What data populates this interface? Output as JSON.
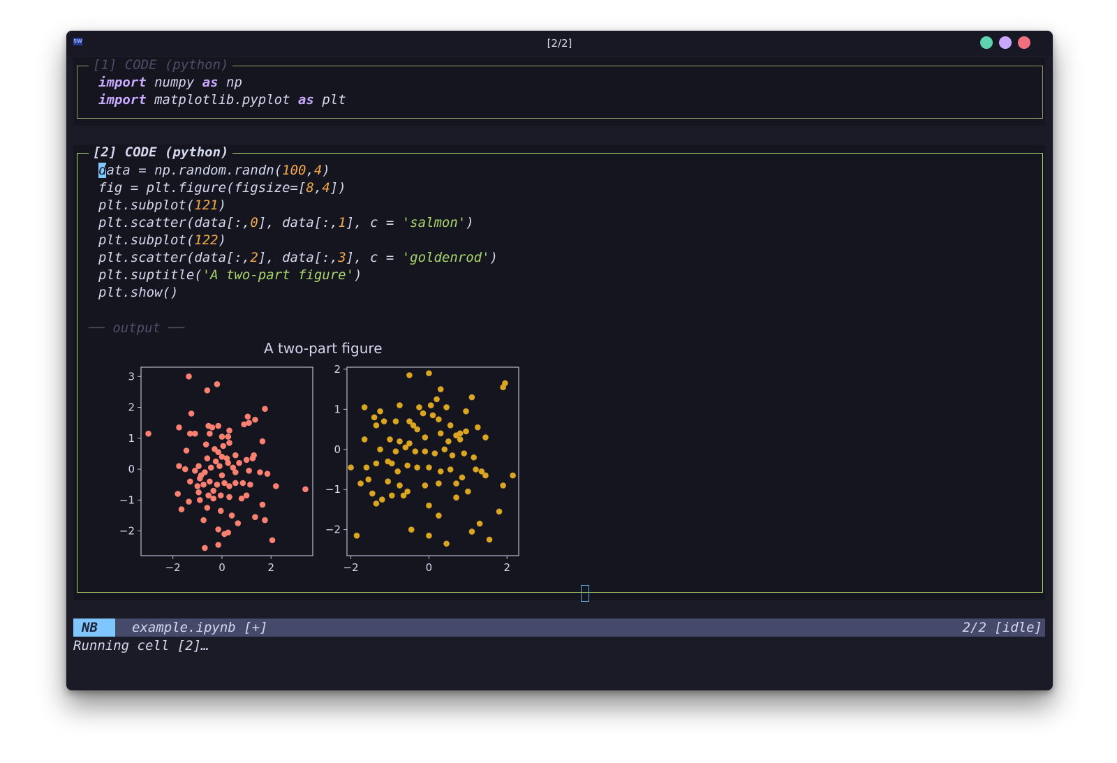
{
  "window": {
    "title": "[2/2]",
    "app_icon_text": "SW",
    "buttons": [
      {
        "name": "green",
        "color": "#5fd3b0"
      },
      {
        "name": "purple",
        "color": "#c9a8ff"
      },
      {
        "name": "red",
        "color": "#f07080"
      }
    ]
  },
  "cells": [
    {
      "label": "[1] CODE (python)",
      "active": false,
      "lines": [
        "import numpy as np",
        "import matplotlib.pyplot as plt"
      ]
    },
    {
      "label": "[2] CODE (python)",
      "active": true,
      "lines": [
        "data = np.random.randn(100,4)",
        "fig = plt.figure(figsize=[8,4])",
        "plt.subplot(121)",
        "plt.scatter(data[:,0], data[:,1], c = 'salmon')",
        "plt.subplot(122)",
        "plt.scatter(data[:,2], data[:,3], c = 'goldenrod')",
        "plt.suptitle('A two-part figure')",
        "plt.show()"
      ],
      "output_label": "── output ──"
    }
  ],
  "colors": {
    "accent_active": "#b5d96a",
    "accent_inactive": "#8fa36a",
    "keyword": "#c9a8ff",
    "number": "#f5a94a",
    "string": "#a9d66b"
  },
  "chart_data": [
    {
      "type": "scatter",
      "title": "A two-part figure",
      "color": "salmon",
      "xticks": [
        "−2",
        "0",
        "2"
      ],
      "yticks": [
        "−2",
        "−1",
        "0",
        "1",
        "2",
        "3"
      ],
      "xlim": [
        -3.3,
        3.7
      ],
      "ylim": [
        -2.8,
        3.3
      ],
      "points": [
        [
          -1.35,
          3.0
        ],
        [
          -0.6,
          2.55
        ],
        [
          -0.2,
          2.75
        ],
        [
          -3.0,
          1.15
        ],
        [
          -1.75,
          1.35
        ],
        [
          -1.25,
          1.8
        ],
        [
          -1.3,
          1.15
        ],
        [
          -1.1,
          1.15
        ],
        [
          -0.55,
          1.4
        ],
        [
          -0.4,
          1.35
        ],
        [
          -0.15,
          1.4
        ],
        [
          -0.5,
          1.15
        ],
        [
          0.0,
          1.05
        ],
        [
          0.3,
          1.25
        ],
        [
          0.25,
          1.05
        ],
        [
          0.9,
          1.45
        ],
        [
          1.05,
          1.7
        ],
        [
          1.1,
          1.5
        ],
        [
          1.35,
          1.6
        ],
        [
          1.75,
          1.95
        ],
        [
          -1.45,
          0.6
        ],
        [
          -0.65,
          0.8
        ],
        [
          -0.3,
          0.65
        ],
        [
          0.05,
          0.75
        ],
        [
          0.3,
          0.85
        ],
        [
          -0.6,
          0.35
        ],
        [
          -0.25,
          0.25
        ],
        [
          0.0,
          0.4
        ],
        [
          0.2,
          0.35
        ],
        [
          0.55,
          0.45
        ],
        [
          1.3,
          0.45
        ],
        [
          1.65,
          0.9
        ],
        [
          -1.75,
          0.1
        ],
        [
          -1.5,
          0.0
        ],
        [
          -1.1,
          -0.05
        ],
        [
          -0.95,
          0.1
        ],
        [
          -0.7,
          -0.1
        ],
        [
          -0.45,
          0.05
        ],
        [
          -0.1,
          0.1
        ],
        [
          0.25,
          0.2
        ],
        [
          0.7,
          0.2
        ],
        [
          1.0,
          0.3
        ],
        [
          1.25,
          0.35
        ],
        [
          1.1,
          -0.05
        ],
        [
          1.55,
          -0.1
        ],
        [
          -1.3,
          -0.4
        ],
        [
          -0.9,
          -0.3
        ],
        [
          -0.75,
          -0.5
        ],
        [
          -0.5,
          -0.4
        ],
        [
          -0.2,
          -0.5
        ],
        [
          0.1,
          -0.45
        ],
        [
          0.3,
          -0.55
        ],
        [
          0.55,
          -0.45
        ],
        [
          0.85,
          -0.45
        ],
        [
          1.15,
          -0.5
        ],
        [
          1.85,
          -0.15
        ],
        [
          2.2,
          -0.55
        ],
        [
          3.4,
          -0.65
        ],
        [
          -1.8,
          -0.8
        ],
        [
          -0.95,
          -0.75
        ],
        [
          -0.9,
          -1.0
        ],
        [
          -0.55,
          -0.85
        ],
        [
          -0.35,
          -0.7
        ],
        [
          0.3,
          -0.9
        ],
        [
          0.8,
          -0.95
        ],
        [
          1.0,
          -0.85
        ],
        [
          -1.65,
          -1.3
        ],
        [
          -1.35,
          -1.05
        ],
        [
          -0.6,
          -1.25
        ],
        [
          -0.35,
          -0.95
        ],
        [
          -0.05,
          -0.85
        ],
        [
          1.65,
          -1.15
        ],
        [
          -0.75,
          -1.65
        ],
        [
          -0.05,
          -1.35
        ],
        [
          0.4,
          -1.5
        ],
        [
          0.65,
          -1.75
        ],
        [
          1.35,
          -1.55
        ],
        [
          1.75,
          -1.65
        ],
        [
          -0.15,
          -1.95
        ],
        [
          0.1,
          -2.1
        ],
        [
          0.25,
          -2.05
        ],
        [
          -0.7,
          -2.55
        ],
        [
          -0.15,
          -2.45
        ],
        [
          2.05,
          -2.3
        ],
        [
          -0.85,
          -0.2
        ],
        [
          0.0,
          -0.2
        ],
        [
          0.55,
          -0.1
        ],
        [
          -1.0,
          -0.55
        ],
        [
          -0.15,
          0.55
        ],
        [
          0.45,
          0.05
        ]
      ]
    },
    {
      "type": "scatter",
      "color": "goldenrod",
      "xticks": [
        "−2",
        "0",
        "2"
      ],
      "yticks": [
        "−2",
        "−1",
        "0",
        "1",
        "2"
      ],
      "xlim": [
        -2.1,
        2.3
      ],
      "ylim": [
        -2.65,
        2.05
      ],
      "points": [
        [
          -0.5,
          1.85
        ],
        [
          0.0,
          1.9
        ],
        [
          0.3,
          1.5
        ],
        [
          1.95,
          1.65
        ],
        [
          1.9,
          1.55
        ],
        [
          -1.65,
          1.05
        ],
        [
          -1.25,
          0.95
        ],
        [
          -0.75,
          1.1
        ],
        [
          -0.25,
          1.05
        ],
        [
          0.05,
          1.1
        ],
        [
          0.2,
          1.25
        ],
        [
          0.45,
          1.05
        ],
        [
          1.1,
          1.3
        ],
        [
          0.95,
          0.95
        ],
        [
          -1.4,
          0.8
        ],
        [
          -1.15,
          0.7
        ],
        [
          -0.85,
          0.7
        ],
        [
          -0.5,
          0.7
        ],
        [
          -0.15,
          0.9
        ],
        [
          0.1,
          0.85
        ],
        [
          0.25,
          0.75
        ],
        [
          -1.35,
          0.6
        ],
        [
          -0.3,
          0.5
        ],
        [
          0.3,
          0.4
        ],
        [
          0.7,
          0.35
        ],
        [
          0.8,
          0.4
        ],
        [
          0.95,
          0.45
        ],
        [
          1.25,
          0.55
        ],
        [
          1.45,
          0.3
        ],
        [
          -1.65,
          0.25
        ],
        [
          -1.0,
          0.25
        ],
        [
          -0.75,
          0.2
        ],
        [
          -0.5,
          0.15
        ],
        [
          -0.1,
          0.3
        ],
        [
          0.5,
          0.2
        ],
        [
          0.8,
          0.25
        ],
        [
          -1.25,
          0.0
        ],
        [
          -0.85,
          -0.05
        ],
        [
          -0.6,
          0.05
        ],
        [
          -0.35,
          -0.05
        ],
        [
          -0.1,
          -0.05
        ],
        [
          0.15,
          -0.1
        ],
        [
          0.4,
          0.0
        ],
        [
          0.6,
          -0.15
        ],
        [
          0.9,
          -0.1
        ],
        [
          1.15,
          -0.2
        ],
        [
          -2.0,
          -0.45
        ],
        [
          -1.6,
          -0.45
        ],
        [
          -1.35,
          -0.35
        ],
        [
          -1.05,
          -0.3
        ],
        [
          -0.8,
          -0.55
        ],
        [
          -0.55,
          -0.4
        ],
        [
          -0.3,
          -0.45
        ],
        [
          0.0,
          -0.45
        ],
        [
          0.3,
          -0.55
        ],
        [
          0.55,
          -0.5
        ],
        [
          0.85,
          -0.7
        ],
        [
          1.2,
          -0.5
        ],
        [
          1.35,
          -0.55
        ],
        [
          1.45,
          -0.65
        ],
        [
          -1.75,
          -0.85
        ],
        [
          -1.55,
          -0.75
        ],
        [
          -1.05,
          -0.8
        ],
        [
          -0.75,
          -0.9
        ],
        [
          -0.55,
          -1.05
        ],
        [
          -0.1,
          -0.9
        ],
        [
          0.25,
          -0.85
        ],
        [
          0.7,
          -0.85
        ],
        [
          1.9,
          -0.9
        ],
        [
          2.15,
          -0.65
        ],
        [
          -1.45,
          -1.1
        ],
        [
          -1.2,
          -1.25
        ],
        [
          -0.95,
          -1.15
        ],
        [
          -0.65,
          -1.15
        ],
        [
          0.0,
          -1.4
        ],
        [
          0.7,
          -1.2
        ],
        [
          1.0,
          -1.05
        ],
        [
          -1.35,
          -1.35
        ],
        [
          0.25,
          -1.65
        ],
        [
          1.3,
          -1.85
        ],
        [
          1.8,
          -1.55
        ],
        [
          -1.85,
          -2.15
        ],
        [
          -0.45,
          -2.0
        ],
        [
          0.0,
          -2.15
        ],
        [
          0.45,
          -2.35
        ],
        [
          1.1,
          -2.05
        ],
        [
          1.55,
          -2.25
        ],
        [
          -0.4,
          0.6
        ],
        [
          0.55,
          0.6
        ],
        [
          -0.95,
          -0.35
        ]
      ]
    }
  ],
  "statusbar": {
    "mode": "NB",
    "filename": "example.ipynb [+]",
    "position": "2/2 [idle]",
    "message": "Running cell [2]…"
  }
}
